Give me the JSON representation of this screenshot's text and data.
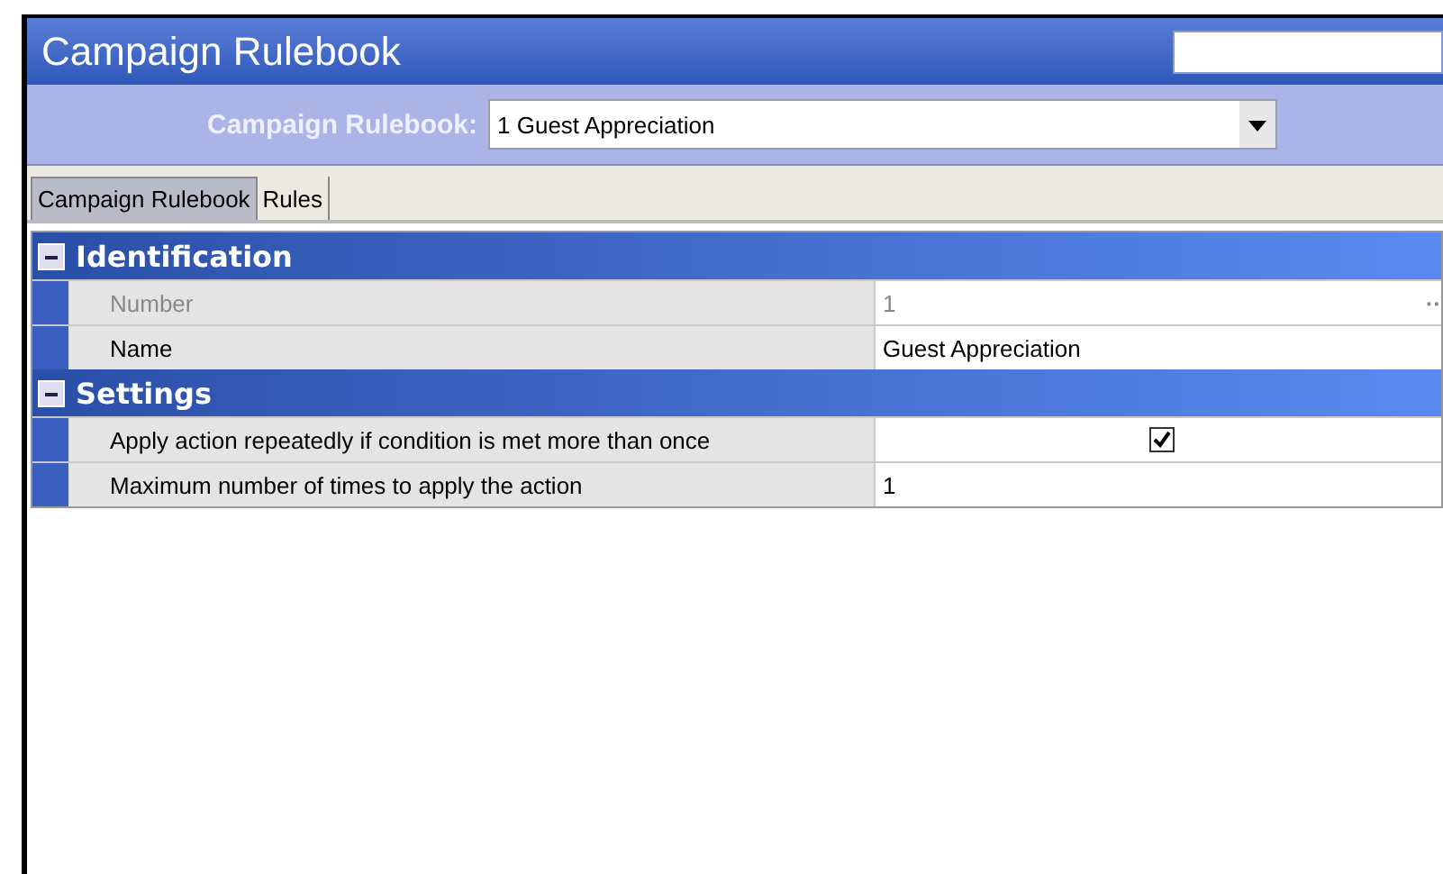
{
  "window": {
    "title": "Campaign Rulebook"
  },
  "selector": {
    "label": "Campaign Rulebook:",
    "value": "1 Guest Appreciation"
  },
  "tabs": [
    {
      "label": "Campaign Rulebook",
      "selected": true
    },
    {
      "label": "Rules",
      "selected": false
    }
  ],
  "groups": [
    {
      "title": "Identification",
      "expanded": true,
      "rows": [
        {
          "kind": "text",
          "label": "Number",
          "value": "1",
          "disabled": true,
          "ellipsis": "··"
        },
        {
          "kind": "text",
          "label": "Name",
          "value": "Guest Appreciation",
          "disabled": false
        }
      ]
    },
    {
      "title": "Settings",
      "expanded": true,
      "rows": [
        {
          "kind": "checkbox",
          "label": "Apply action repeatedly if condition is met more than once",
          "checked": true,
          "disabled": false
        },
        {
          "kind": "text",
          "label": "Maximum number of times to apply the action",
          "value": "1",
          "disabled": false
        }
      ]
    }
  ]
}
